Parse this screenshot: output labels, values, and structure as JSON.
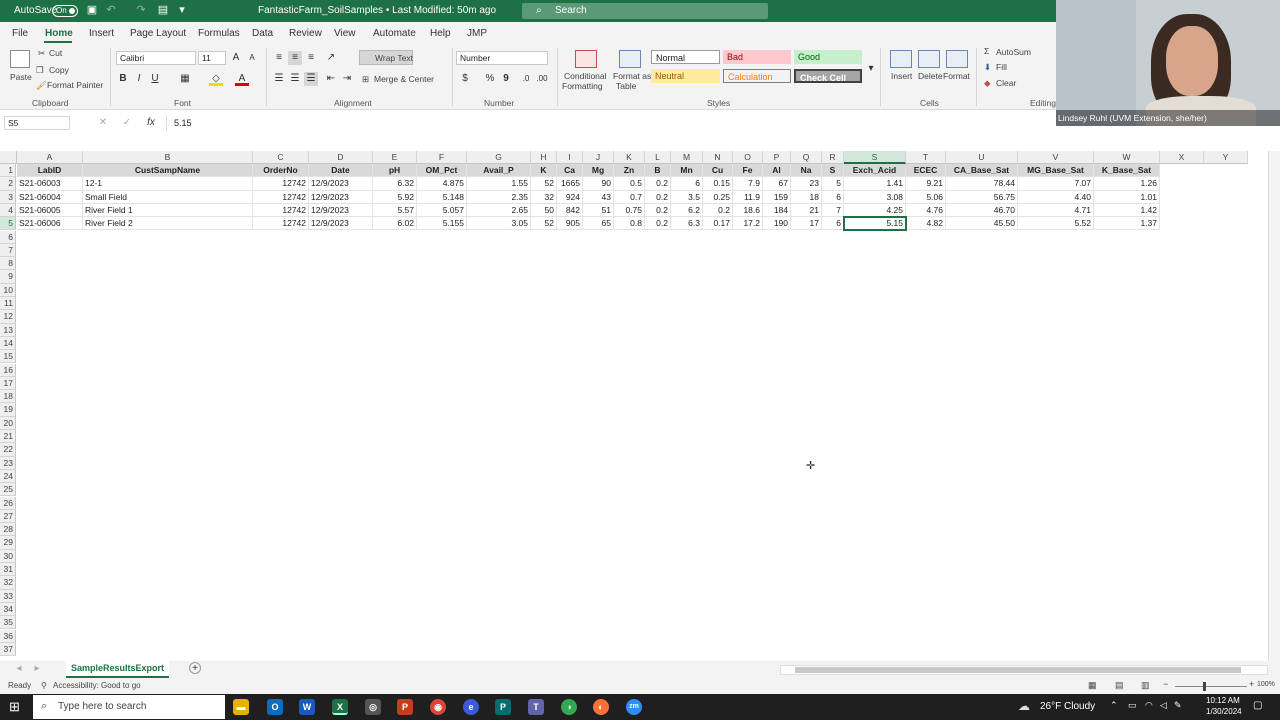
{
  "titlebar": {
    "autosave_label": "AutoSave",
    "autosave_state": "On",
    "doc_title": "FantasticFarm_SoilSamples • Last Modified: 50m ago",
    "search_placeholder": "Search"
  },
  "menu": [
    "File",
    "Home",
    "Insert",
    "Page Layout",
    "Formulas",
    "Data",
    "Review",
    "View",
    "Automate",
    "Help",
    "JMP"
  ],
  "ribbon": {
    "clipboard": {
      "paste": "Paste",
      "cut": "Cut",
      "copy": "Copy",
      "format_painter": "Format Painter",
      "group": "Clipboard"
    },
    "font": {
      "name": "Calibri",
      "size": "11",
      "bold": "B",
      "italic": "I",
      "underline": "U",
      "group": "Font"
    },
    "alignment": {
      "wrap_text": "Wrap Text",
      "merge_center": "Merge & Center",
      "group": "Alignment"
    },
    "number": {
      "format": "Number",
      "currency": "$",
      "percent": "%",
      "comma": "9",
      "group": "Number"
    },
    "styles": {
      "conditional": "Conditional",
      "formatting": "Formatting",
      "format_as": "Format as",
      "table": "Table",
      "normal": "Normal",
      "bad": "Bad",
      "good": "Good",
      "neutral": "Neutral",
      "calculation": "Calculation",
      "check_cell": "Check Cell",
      "group": "Styles"
    },
    "cells": {
      "insert": "Insert",
      "delete": "Delete",
      "format": "Format",
      "group": "Cells"
    },
    "editing": {
      "autosum": "AutoSum",
      "fill": "Fill",
      "clear": "Clear",
      "group": "Editing"
    }
  },
  "formula_bar": {
    "name_box": "S5",
    "value": "5.15"
  },
  "columns": [
    "A",
    "B",
    "C",
    "D",
    "E",
    "F",
    "G",
    "H",
    "I",
    "J",
    "K",
    "L",
    "M",
    "N",
    "O",
    "P",
    "Q",
    "R",
    "S",
    "T",
    "U",
    "V",
    "W",
    "X",
    "Y"
  ],
  "selected_column": "S",
  "sheet": {
    "headers": [
      "LabID",
      "CustSampName",
      "OrderNo",
      "Date",
      "pH",
      "OM_Pct",
      "Avail_P",
      "K",
      "Ca",
      "Mg",
      "Zn",
      "B",
      "Mn",
      "Cu",
      "Fe",
      "Al",
      "Na",
      "S",
      "Exch_Acid",
      "ECEC",
      "CA_Base_Sat",
      "MG_Base_Sat",
      "K_Base_Sat"
    ],
    "rows": [
      [
        "S21-06003",
        "12-1",
        "12742",
        "12/9/2023",
        "6.32",
        "4.875",
        "1.55",
        "52",
        "1665",
        "90",
        "0.5",
        "0.2",
        "6",
        "0.15",
        "7.9",
        "67",
        "23",
        "5",
        "1.41",
        "9.21",
        "78.44",
        "7.07",
        "1.26"
      ],
      [
        "S21-06004",
        "Small Field",
        "12742",
        "12/9/2023",
        "5.92",
        "5.148",
        "2.35",
        "32",
        "924",
        "43",
        "0.7",
        "0.2",
        "3.5",
        "0.25",
        "11.9",
        "159",
        "18",
        "6",
        "3.08",
        "5.06",
        "56.75",
        "4.40",
        "1.01"
      ],
      [
        "S21-06005",
        "River Field 1",
        "12742",
        "12/9/2023",
        "5.57",
        "5.057",
        "2.65",
        "50",
        "842",
        "51",
        "0.75",
        "0.2",
        "6.2",
        "0.2",
        "18.6",
        "184",
        "21",
        "7",
        "4.25",
        "4.76",
        "46.70",
        "4.71",
        "1.42"
      ],
      [
        "S21-06006",
        "River Field 2",
        "12742",
        "12/9/2023",
        "6.02",
        "5.155",
        "3.05",
        "52",
        "905",
        "65",
        "0.8",
        "0.2",
        "6.3",
        "0.17",
        "17.2",
        "190",
        "17",
        "6",
        "5.15",
        "4.82",
        "45.50",
        "5.52",
        "1.37"
      ]
    ],
    "row_count": 37
  },
  "sheet_tab": "SampleResultsExport",
  "status": {
    "ready": "Ready",
    "accessibility": "Accessibility: Good to go",
    "zoom": "100%"
  },
  "webcam": {
    "name": "Lindsey Ruhl (UVM Extension, she/her)"
  },
  "taskbar": {
    "search_placeholder": "Type here to search",
    "weather": "26°F  Cloudy",
    "time": "10:12 AM",
    "date": "1/30/2024"
  },
  "colors": {
    "excel_green": "#1e7145",
    "header_fill": "#d9d9d9"
  }
}
